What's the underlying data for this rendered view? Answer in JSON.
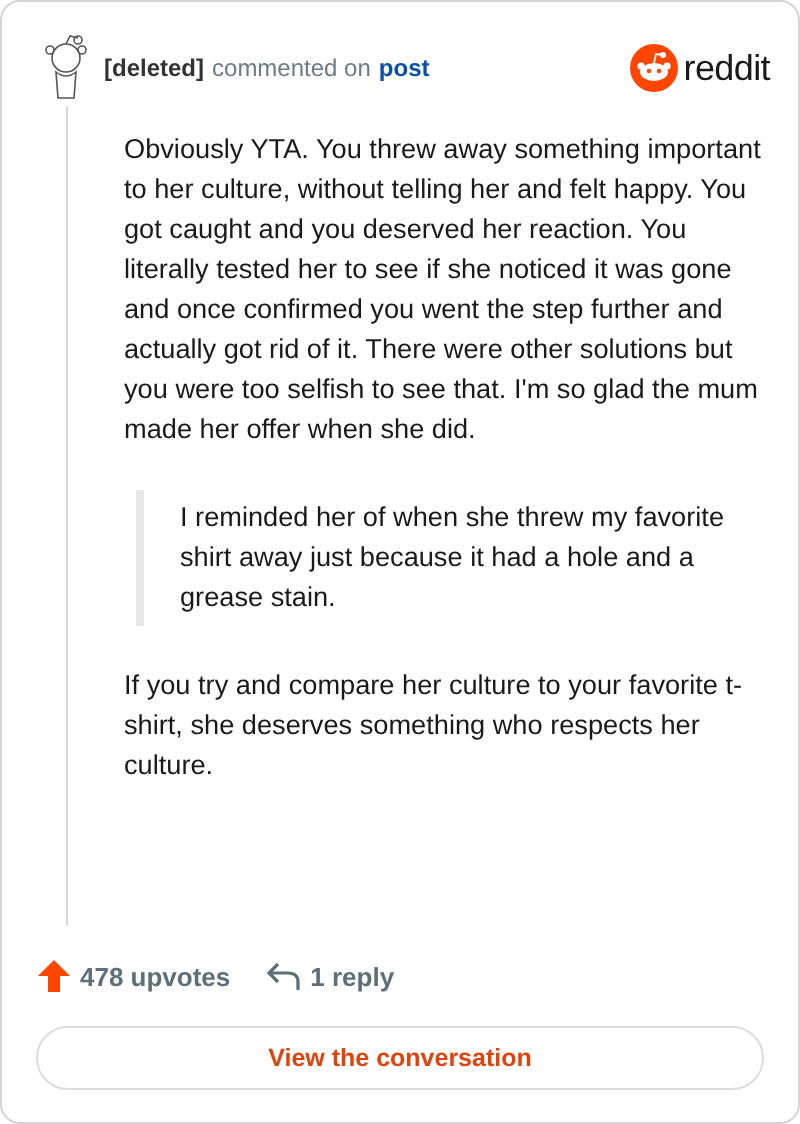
{
  "header": {
    "author": "[deleted]",
    "action": "commented on",
    "link": "post",
    "brand": "reddit"
  },
  "body": [
    {
      "kind": "paragraph",
      "text": "Obviously YTA. You threw away something important to her culture, without telling her and felt happy. You got caught and you deserved her reaction. You literally tested her to see if she noticed it was gone and once confirmed you went the step further and actually got rid of it. There were other solutions but you were too selfish to see that. I'm so glad the mum made her offer when she did."
    },
    {
      "kind": "quote",
      "text": "I reminded her of when she threw my favorite shirt away just because it had a hole and a grease stain."
    },
    {
      "kind": "paragraph",
      "text": "If you try and compare her culture to your favorite t-shirt, she deserves something who respects her culture."
    }
  ],
  "footer": {
    "upvotes": "478 upvotes",
    "replies": "1 reply",
    "button": "View the conversation"
  }
}
